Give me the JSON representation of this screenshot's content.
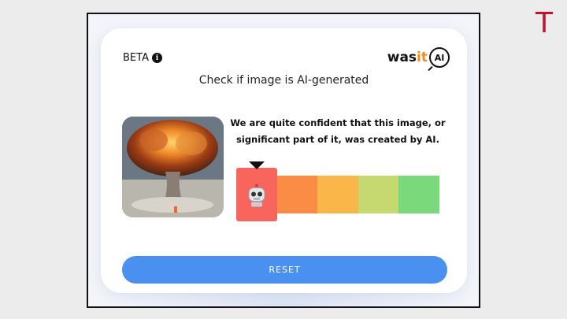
{
  "corner_mark": "T",
  "widget": {
    "beta_label": "BETA",
    "info_icon": "info-icon",
    "logo": {
      "part1": "was",
      "part2": "it",
      "part3": "AI"
    },
    "title": "Check if image is AI-generated",
    "result_text": "We are quite confident that this image, or significant part of it, was created by AI.",
    "reset_label": "RESET",
    "meter": {
      "selected_index": 0,
      "segment_colors": [
        "#f7655d",
        "#fb8c46",
        "#fbb64a",
        "#c6d971",
        "#7ad97a"
      ],
      "marker_icon": "robot-icon"
    },
    "colors": {
      "button": "#4a90f0",
      "logo_accent": "#f28a1c"
    }
  }
}
